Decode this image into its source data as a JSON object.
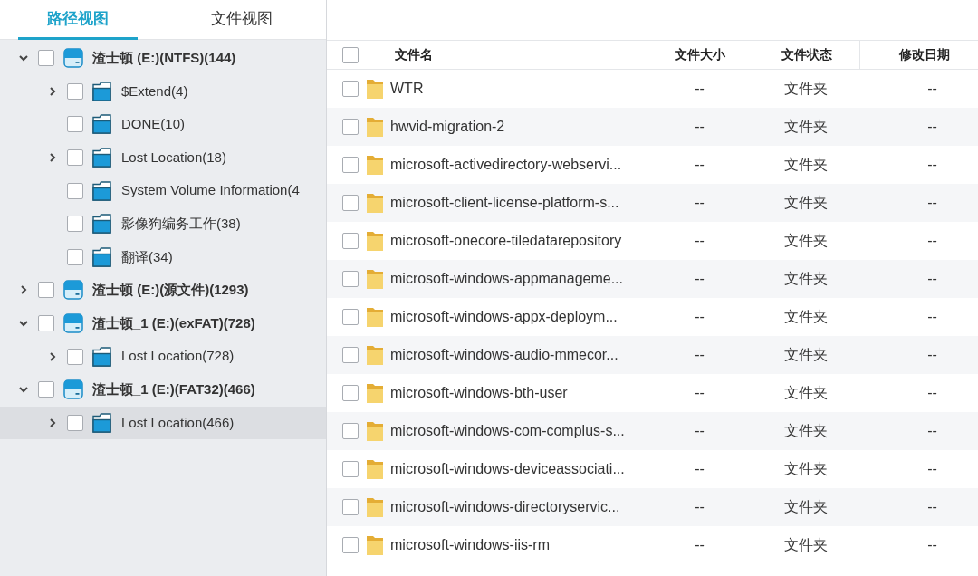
{
  "tabs": [
    {
      "label": "路径视图",
      "selected": true
    },
    {
      "label": "文件视图",
      "selected": false
    }
  ],
  "tree": [
    {
      "label": "渣士顿 (E:)(NTFS)(144)",
      "kind": "drive",
      "expanded": true,
      "checked": false,
      "selected": false,
      "children": [
        {
          "label": "$Extend(4)",
          "kind": "folder",
          "expanded": false,
          "checked": false,
          "selected": false
        },
        {
          "label": "DONE(10)",
          "kind": "folder",
          "checked": false,
          "selected": false
        },
        {
          "label": "Lost Location(18)",
          "kind": "folder",
          "expanded": false,
          "checked": false,
          "selected": false
        },
        {
          "label": "System Volume Information(4",
          "kind": "folder",
          "checked": false,
          "selected": false
        },
        {
          "label": "影像狗编务工作(38)",
          "kind": "folder",
          "checked": false,
          "selected": false
        },
        {
          "label": "翻译(34)",
          "kind": "folder",
          "checked": false,
          "selected": false
        }
      ]
    },
    {
      "label": "渣士顿 (E:)(源文件)(1293)",
      "kind": "drive",
      "expanded": false,
      "checked": false,
      "selected": false
    },
    {
      "label": "渣士顿_1 (E:)(exFAT)(728)",
      "kind": "drive",
      "expanded": true,
      "checked": false,
      "selected": false,
      "children": [
        {
          "label": "Lost Location(728)",
          "kind": "folder",
          "expanded": false,
          "checked": false,
          "selected": false
        }
      ]
    },
    {
      "label": "渣士顿_1 (E:)(FAT32)(466)",
      "kind": "drive",
      "expanded": true,
      "checked": false,
      "selected": false,
      "children": [
        {
          "label": "Lost Location(466)",
          "kind": "folder",
          "expanded": false,
          "checked": false,
          "selected": true
        }
      ]
    }
  ],
  "table": {
    "select_all": {
      "checked": false
    },
    "columns": [
      {
        "label": "文件名"
      },
      {
        "label": "文件大小"
      },
      {
        "label": "文件状态"
      },
      {
        "label": "修改日期"
      }
    ],
    "rows": [
      {
        "checked": false,
        "name": "WTR",
        "size": "--",
        "status": "文件夹",
        "modified": "--"
      },
      {
        "checked": false,
        "name": "hwvid-migration-2",
        "size": "--",
        "status": "文件夹",
        "modified": "--"
      },
      {
        "checked": false,
        "name": "microsoft-activedirectory-webservi...",
        "size": "--",
        "status": "文件夹",
        "modified": "--"
      },
      {
        "checked": false,
        "name": "microsoft-client-license-platform-s...",
        "size": "--",
        "status": "文件夹",
        "modified": "--"
      },
      {
        "checked": false,
        "name": "microsoft-onecore-tiledatarepository",
        "size": "--",
        "status": "文件夹",
        "modified": "--"
      },
      {
        "checked": false,
        "name": "microsoft-windows-appmanageme...",
        "size": "--",
        "status": "文件夹",
        "modified": "--"
      },
      {
        "checked": false,
        "name": "microsoft-windows-appx-deploym...",
        "size": "--",
        "status": "文件夹",
        "modified": "--"
      },
      {
        "checked": false,
        "name": "microsoft-windows-audio-mmecor...",
        "size": "--",
        "status": "文件夹",
        "modified": "--"
      },
      {
        "checked": false,
        "name": "microsoft-windows-bth-user",
        "size": "--",
        "status": "文件夹",
        "modified": "--"
      },
      {
        "checked": false,
        "name": "microsoft-windows-com-complus-s...",
        "size": "--",
        "status": "文件夹",
        "modified": "--"
      },
      {
        "checked": false,
        "name": "microsoft-windows-deviceassociati...",
        "size": "--",
        "status": "文件夹",
        "modified": "--"
      },
      {
        "checked": false,
        "name": "microsoft-windows-directoryservic...",
        "size": "--",
        "status": "文件夹",
        "modified": "--"
      },
      {
        "checked": false,
        "name": "microsoft-windows-iis-rm",
        "size": "--",
        "status": "文件夹",
        "modified": "--"
      }
    ]
  }
}
